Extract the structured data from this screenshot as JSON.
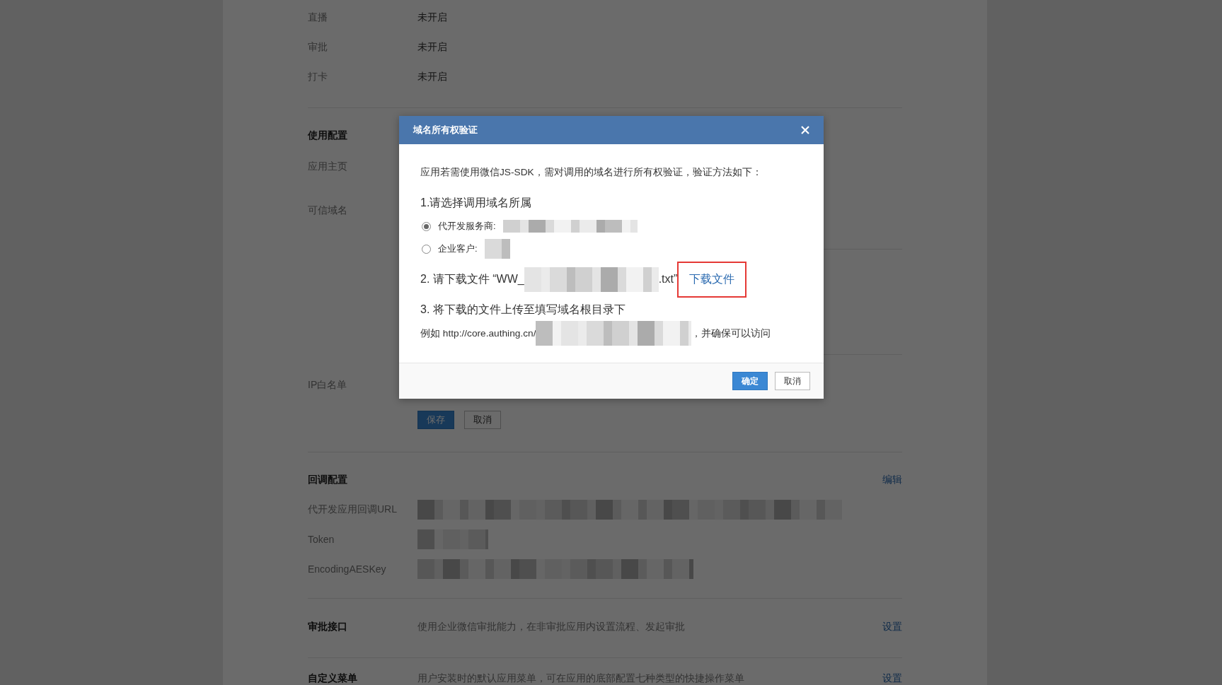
{
  "page": {
    "status_rows": [
      {
        "label": "直播",
        "value": "未开启"
      },
      {
        "label": "审批",
        "value": "未开启"
      },
      {
        "label": "打卡",
        "value": "未开启"
      }
    ],
    "usage_config": {
      "title": "使用配置",
      "home_label": "应用主页",
      "domain_label": "可信域名",
      "ip_label": "IP白名单",
      "buttons": [
        {
          "label": "保存",
          "kind": "primary"
        },
        {
          "label": "取消",
          "kind": "default"
        }
      ]
    },
    "callback_config": {
      "title": "回调配置",
      "action": "编辑",
      "fields": [
        {
          "label": "代开发应用回调URL"
        },
        {
          "label": "Token"
        },
        {
          "label": "EncodingAESKey"
        }
      ]
    },
    "approval_api": {
      "title": "审批接口",
      "description": "使用企业微信审批能力，在非审批应用内设置流程、发起审批",
      "action": "设置"
    },
    "custom_menu": {
      "title": "自定义菜单",
      "description": "用户安装时的默认应用菜单，可在应用的底部配置七种类型的快捷操作菜单",
      "action": "设置"
    }
  },
  "dialog": {
    "title": "域名所有权验证",
    "intro": "应用若需使用微信JS-SDK，需对调用的域名进行所有权验证，验证方法如下：",
    "step1": {
      "title": "1.请选择调用域名所属",
      "options": [
        {
          "label": "代开发服务商:",
          "selected": true
        },
        {
          "label": "企业客户:",
          "selected": false
        }
      ]
    },
    "step2": {
      "prefix": "2. 请下载文件 “WW_",
      "suffix": ".txt”",
      "link": "下载文件",
      "highlighted": true
    },
    "step3": {
      "title": "3. 将下载的文件上传至填写域名根目录下",
      "example_prefix": "例如 http://core.authing.cn/",
      "example_suffix": "，并确保可以访问"
    },
    "buttons": [
      {
        "label": "确定",
        "kind": "primary"
      },
      {
        "label": "取消",
        "kind": "default"
      }
    ]
  }
}
